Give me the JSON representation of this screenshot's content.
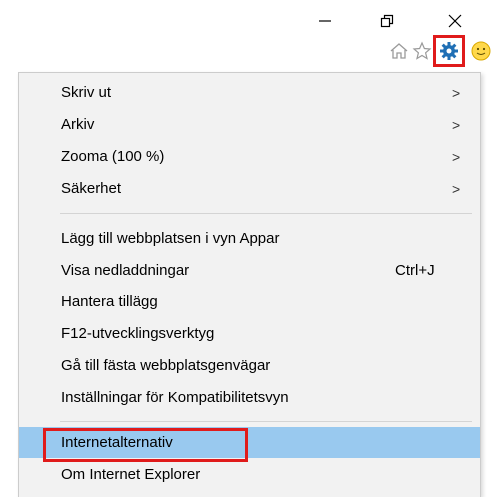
{
  "window": {
    "controls": {
      "minimize": "minimize-icon",
      "restore": "restore-icon",
      "close": "close-icon"
    }
  },
  "toolbar": {
    "icons": [
      "home-icon",
      "star-icon",
      "gear-icon",
      "smiley-icon"
    ],
    "gear_highlight_color": "#e01b1b"
  },
  "menu": {
    "items": [
      {
        "label": "Skriv ut",
        "submenu": ">"
      },
      {
        "label": "Arkiv",
        "submenu": ">"
      },
      {
        "label": "Zooma (100 %)",
        "submenu": ">"
      },
      {
        "label": "Säkerhet",
        "submenu": ">"
      },
      {
        "label": "Lägg till webbplatsen i vyn Appar"
      },
      {
        "label": "Visa nedladdningar",
        "shortcut": "Ctrl+J"
      },
      {
        "label": "Hantera tillägg"
      },
      {
        "label": "F12-utvecklingsverktyg"
      },
      {
        "label": "Gå till fästa webbplatsgenvägar"
      },
      {
        "label": "Inställningar för Kompatibilitetsvyn"
      },
      {
        "label": "Internetalternativ",
        "highlighted": true
      },
      {
        "label": "Om Internet Explorer"
      }
    ],
    "highlight_color": "#99c9ef"
  }
}
